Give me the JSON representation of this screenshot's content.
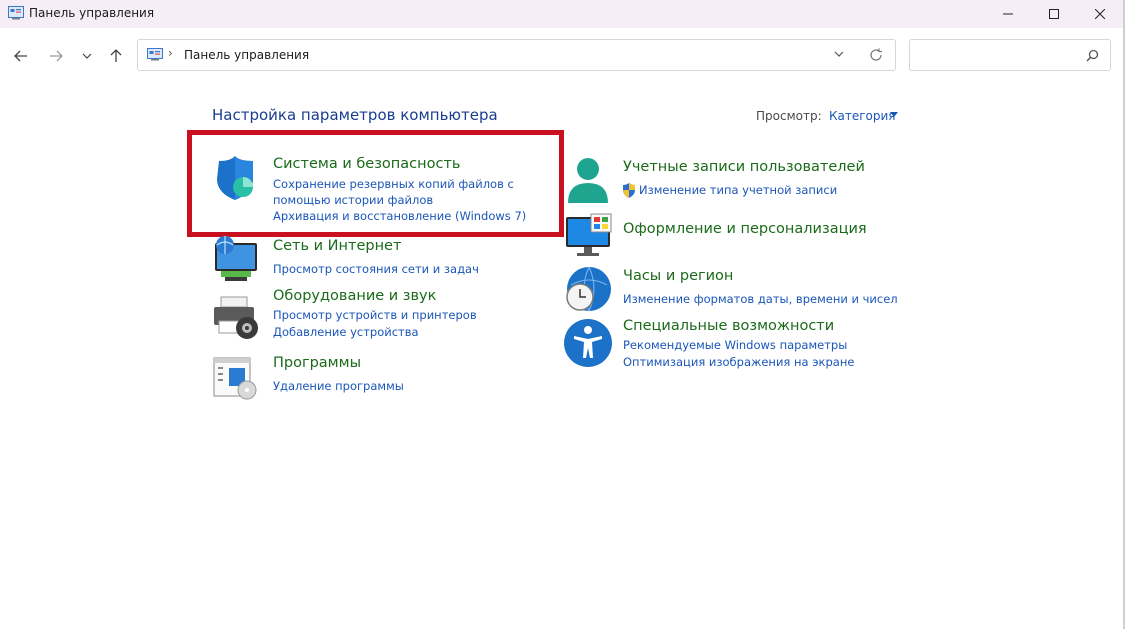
{
  "window": {
    "title": "Панель управления"
  },
  "address": {
    "path": "Панель управления",
    "separator": "›"
  },
  "search": {
    "placeholder": ""
  },
  "content": {
    "title": "Настройка параметров компьютера",
    "view_label": "Просмотр:",
    "view_value": "Категория"
  },
  "categories": {
    "system": {
      "title": "Система и безопасность",
      "links": [
        "Сохранение резервных копий файлов с помощью истории файлов",
        "Архивация и восстановление (Windows 7)"
      ]
    },
    "network": {
      "title": "Сеть и Интернет",
      "links": [
        "Просмотр состояния сети и задач"
      ]
    },
    "hardware": {
      "title": "Оборудование и звук",
      "links": [
        "Просмотр устройств и принтеров",
        "Добавление устройства"
      ]
    },
    "programs": {
      "title": "Программы",
      "links": [
        "Удаление программы"
      ]
    },
    "accounts": {
      "title": "Учетные записи пользователей",
      "links": [
        "Изменение типа учетной записи"
      ]
    },
    "appearance": {
      "title": "Оформление и персонализация",
      "links": []
    },
    "clock": {
      "title": "Часы и регион",
      "links": [
        "Изменение форматов даты, времени и чисел"
      ]
    },
    "ease": {
      "title": "Специальные возможности",
      "links": [
        "Рекомендуемые Windows параметры",
        "Оптимизация изображения на экране"
      ]
    }
  },
  "icons": {
    "app": "control-panel-icon",
    "back": "arrow-left-icon",
    "forward": "arrow-right-icon",
    "recent": "chevron-down-icon",
    "up": "arrow-up-icon",
    "refresh": "refresh-icon",
    "search": "search-icon",
    "minimize": "minimize-icon",
    "maximize": "maximize-icon",
    "close": "close-icon"
  },
  "colors": {
    "category_title": "#1b6b1b",
    "link": "#1a56b8",
    "page_title": "#1a3d8f",
    "highlight": "#c8101e",
    "titlebar": "#f5eef6"
  }
}
